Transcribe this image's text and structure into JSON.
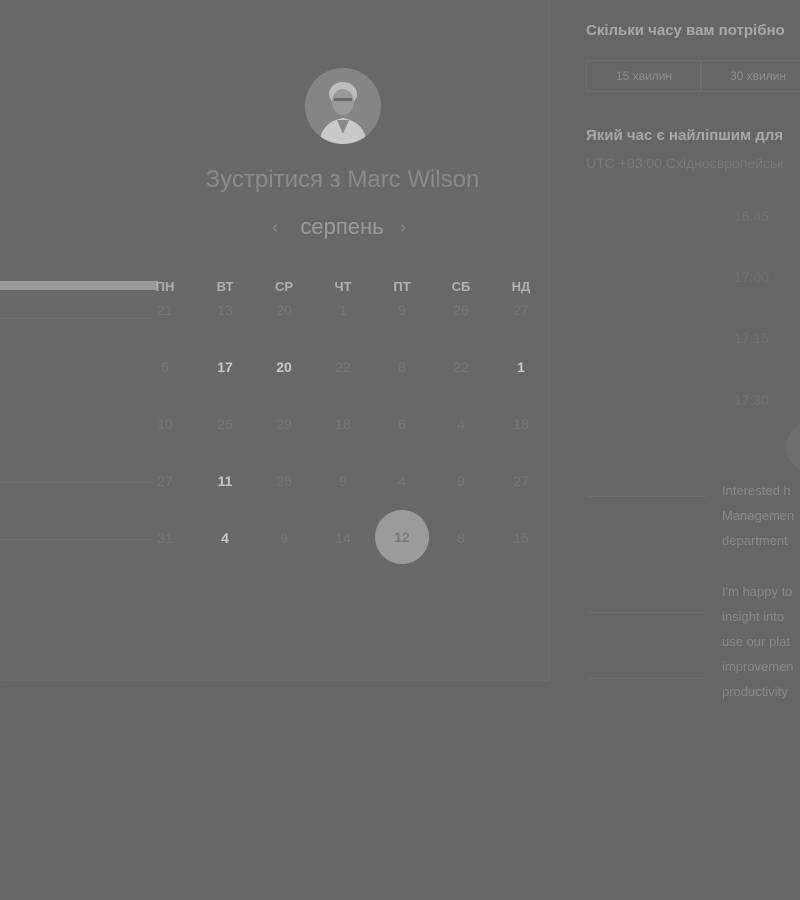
{
  "meeting": {
    "title_prefix": "Зустрітися з",
    "host_name": "Marc Wilson"
  },
  "calendar": {
    "month": "серпень",
    "weekdays": [
      "ПН",
      "ВТ",
      "СР",
      "ЧТ",
      "ПТ",
      "СБ",
      "НД"
    ],
    "weeks": [
      [
        "21",
        "13",
        "20",
        "1",
        "9",
        "26",
        "27"
      ],
      [
        "6",
        "17",
        "20",
        "22",
        "8",
        "22",
        "1"
      ],
      [
        "10",
        "26",
        "29",
        "18",
        "6",
        "4",
        "18"
      ],
      [
        "27",
        "11",
        "25",
        "9",
        "4",
        "9",
        "27"
      ],
      [
        "31",
        "4",
        "9",
        "14",
        "12",
        "8",
        "15"
      ]
    ],
    "available_days": [
      "17",
      "20",
      "1",
      "11",
      "4"
    ],
    "selected_day": "12"
  },
  "duration": {
    "heading": "Скільки часу вам потрібно",
    "options": [
      "15 хвилин",
      "30 хвилин"
    ]
  },
  "time": {
    "heading": "Який час є найліпшим для",
    "timezone": "UTC +03:00 Східноєвропейськ",
    "slots": [
      "16:45",
      "17:00",
      "17:15",
      "17:30"
    ]
  },
  "faq": {
    "lines_1": [
      "Interested h",
      "Managemen",
      "department"
    ],
    "lines_2": [
      "I'm happy to",
      "insight into",
      "use our plat",
      "improvemen",
      "productivity"
    ]
  }
}
